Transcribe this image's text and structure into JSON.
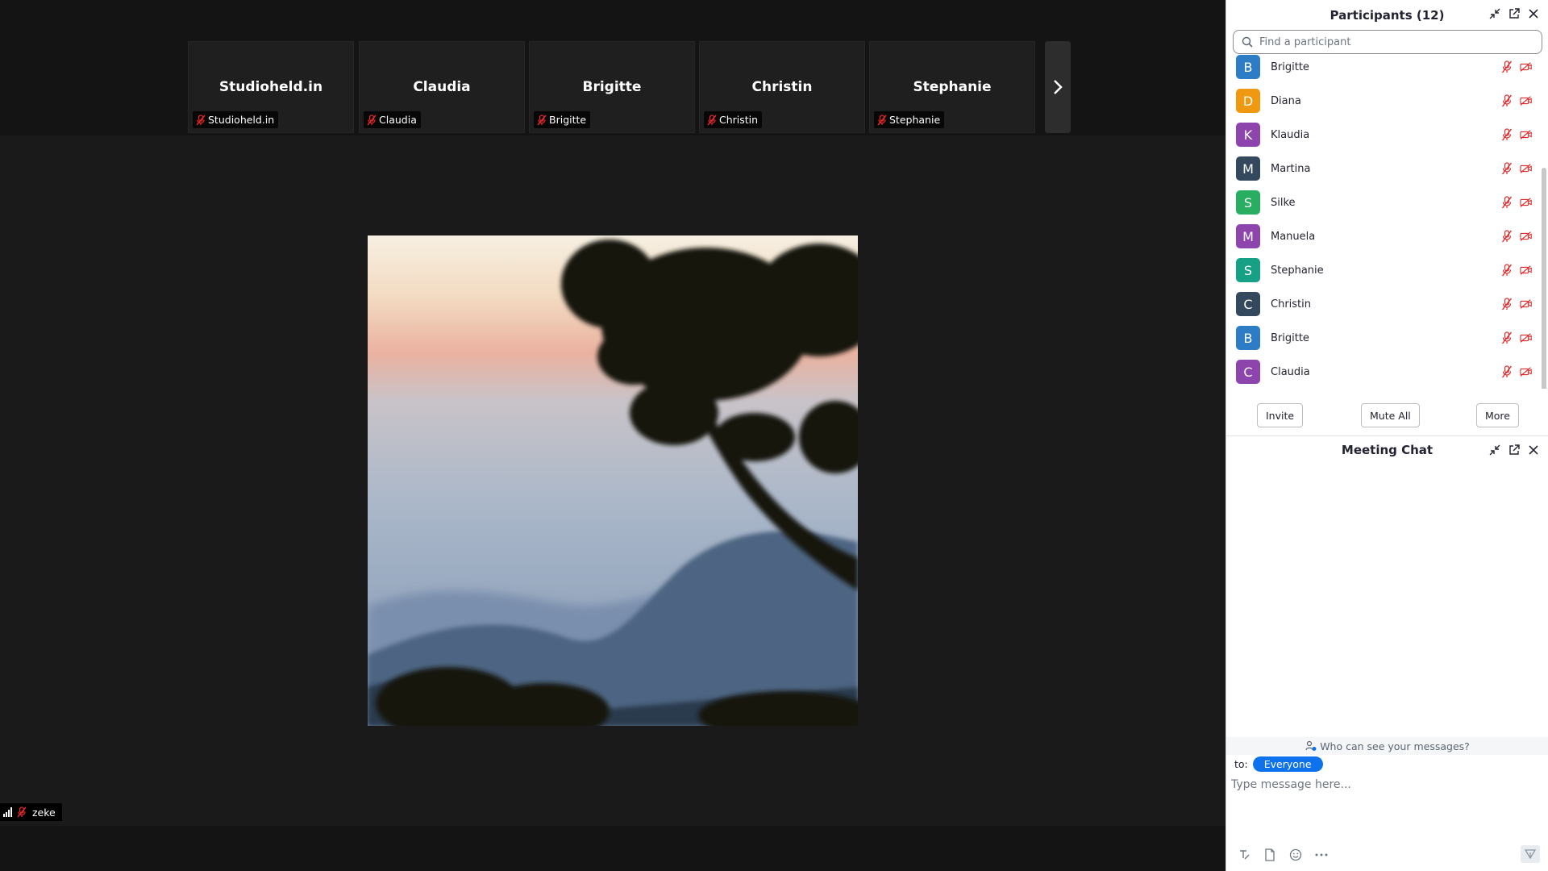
{
  "meeting": {
    "tiles": [
      {
        "name": "Studioheld.in",
        "label": "Studioheld.in"
      },
      {
        "name": "Claudia",
        "label": "Claudia"
      },
      {
        "name": "Brigitte",
        "label": "Brigitte"
      },
      {
        "name": "Christin",
        "label": "Christin"
      },
      {
        "name": "Stephanie",
        "label": "Stephanie"
      }
    ],
    "self_label": "zeke"
  },
  "participants": {
    "title": "Participants (12)",
    "search_placeholder": "Find a participant",
    "list": [
      {
        "initial": "B",
        "name": "Brigitte",
        "color": "#2d7dc6"
      },
      {
        "initial": "D",
        "name": "Diana",
        "color": "#f19811"
      },
      {
        "initial": "K",
        "name": "Klaudia",
        "color": "#8e44ad"
      },
      {
        "initial": "M",
        "name": "Martina",
        "color": "#34495e"
      },
      {
        "initial": "S",
        "name": "Silke",
        "color": "#27ae60"
      },
      {
        "initial": "M",
        "name": "Manuela",
        "color": "#8e44ad"
      },
      {
        "initial": "S",
        "name": "Stephanie",
        "color": "#16a085"
      },
      {
        "initial": "C",
        "name": "Christin",
        "color": "#34495e"
      },
      {
        "initial": "B",
        "name": "Brigitte",
        "color": "#2d7dc6"
      },
      {
        "initial": "C",
        "name": "Claudia",
        "color": "#8e44ad"
      }
    ],
    "buttons": {
      "invite": "Invite",
      "mute_all": "Mute All",
      "more": "More"
    }
  },
  "chat": {
    "title": "Meeting Chat",
    "who_can_see": "Who can see your messages?",
    "to_label": "to:",
    "recipient": "Everyone",
    "input_placeholder": "Type message here..."
  },
  "colors": {
    "muted_icon": "#e02828",
    "accent": "#0e72ed"
  }
}
